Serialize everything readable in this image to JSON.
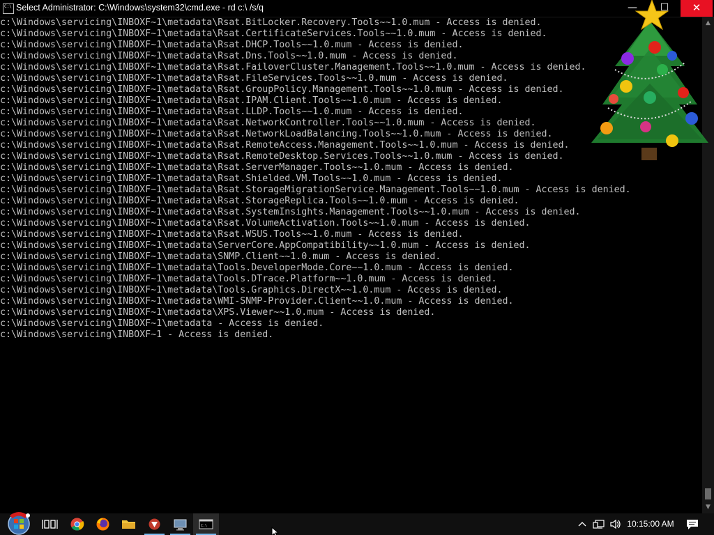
{
  "window": {
    "title": "Select Administrator: C:\\Windows\\system32\\cmd.exe - rd  c:\\ /s/q",
    "minimize_label": "—",
    "maximize_label": "☐",
    "close_label": "✕"
  },
  "console": {
    "lines": [
      "c:\\Windows\\servicing\\INBOXF~1\\metadata\\Rsat.BitLocker.Recovery.Tools~~1.0.mum - Access is denied.",
      "c:\\Windows\\servicing\\INBOXF~1\\metadata\\Rsat.CertificateServices.Tools~~1.0.mum - Access is denied.",
      "c:\\Windows\\servicing\\INBOXF~1\\metadata\\Rsat.DHCP.Tools~~1.0.mum - Access is denied.",
      "c:\\Windows\\servicing\\INBOXF~1\\metadata\\Rsat.Dns.Tools~~1.0.mum - Access is denied.",
      "c:\\Windows\\servicing\\INBOXF~1\\metadata\\Rsat.FailoverCluster.Management.Tools~~1.0.mum - Access is denied.",
      "c:\\Windows\\servicing\\INBOXF~1\\metadata\\Rsat.FileServices.Tools~~1.0.mum - Access is denied.",
      "c:\\Windows\\servicing\\INBOXF~1\\metadata\\Rsat.GroupPolicy.Management.Tools~~1.0.mum - Access is denied.",
      "c:\\Windows\\servicing\\INBOXF~1\\metadata\\Rsat.IPAM.Client.Tools~~1.0.mum - Access is denied.",
      "c:\\Windows\\servicing\\INBOXF~1\\metadata\\Rsat.LLDP.Tools~~1.0.mum - Access is denied.",
      "c:\\Windows\\servicing\\INBOXF~1\\metadata\\Rsat.NetworkController.Tools~~1.0.mum - Access is denied.",
      "c:\\Windows\\servicing\\INBOXF~1\\metadata\\Rsat.NetworkLoadBalancing.Tools~~1.0.mum - Access is denied.",
      "c:\\Windows\\servicing\\INBOXF~1\\metadata\\Rsat.RemoteAccess.Management.Tools~~1.0.mum - Access is denied.",
      "c:\\Windows\\servicing\\INBOXF~1\\metadata\\Rsat.RemoteDesktop.Services.Tools~~1.0.mum - Access is denied.",
      "c:\\Windows\\servicing\\INBOXF~1\\metadata\\Rsat.ServerManager.Tools~~1.0.mum - Access is denied.",
      "c:\\Windows\\servicing\\INBOXF~1\\metadata\\Rsat.Shielded.VM.Tools~~1.0.mum - Access is denied.",
      "c:\\Windows\\servicing\\INBOXF~1\\metadata\\Rsat.StorageMigrationService.Management.Tools~~1.0.mum - Access is denied.",
      "c:\\Windows\\servicing\\INBOXF~1\\metadata\\Rsat.StorageReplica.Tools~~1.0.mum - Access is denied.",
      "c:\\Windows\\servicing\\INBOXF~1\\metadata\\Rsat.SystemInsights.Management.Tools~~1.0.mum - Access is denied.",
      "c:\\Windows\\servicing\\INBOXF~1\\metadata\\Rsat.VolumeActivation.Tools~~1.0.mum - Access is denied.",
      "c:\\Windows\\servicing\\INBOXF~1\\metadata\\Rsat.WSUS.Tools~~1.0.mum - Access is denied.",
      "c:\\Windows\\servicing\\INBOXF~1\\metadata\\ServerCore.AppCompatibility~~1.0.mum - Access is denied.",
      "c:\\Windows\\servicing\\INBOXF~1\\metadata\\SNMP.Client~~1.0.mum - Access is denied.",
      "c:\\Windows\\servicing\\INBOXF~1\\metadata\\Tools.DeveloperMode.Core~~1.0.mum - Access is denied.",
      "c:\\Windows\\servicing\\INBOXF~1\\metadata\\Tools.DTrace.Platform~~1.0.mum - Access is denied.",
      "c:\\Windows\\servicing\\INBOXF~1\\metadata\\Tools.Graphics.DirectX~~1.0.mum - Access is denied.",
      "c:\\Windows\\servicing\\INBOXF~1\\metadata\\WMI-SNMP-Provider.Client~~1.0.mum - Access is denied.",
      "c:\\Windows\\servicing\\INBOXF~1\\metadata\\XPS.Viewer~~1.0.mum - Access is denied.",
      "c:\\Windows\\servicing\\INBOXF~1\\metadata - Access is denied.",
      "c:\\Windows\\servicing\\INBOXF~1 - Access is denied."
    ],
    "colors": {
      "background": "#000000",
      "text": "#c0c0c0"
    }
  },
  "taskbar": {
    "items": [
      {
        "icon": "start-orb-icon"
      },
      {
        "icon": "task-view-icon"
      },
      {
        "icon": "chrome-icon"
      },
      {
        "icon": "firefox-icon"
      },
      {
        "icon": "file-explorer-icon"
      },
      {
        "icon": "app-icon"
      },
      {
        "icon": "remote-desktop-icon"
      },
      {
        "icon": "command-prompt-icon"
      }
    ],
    "tray": {
      "icons": [
        "chevron-up-icon",
        "network-icon",
        "volume-icon"
      ],
      "clock": "10:15:00 AM"
    }
  }
}
